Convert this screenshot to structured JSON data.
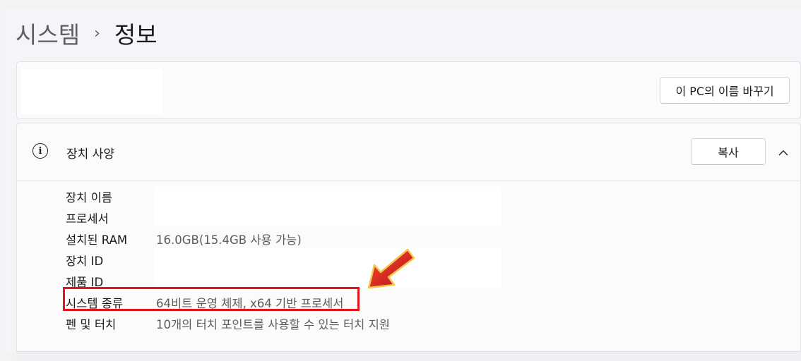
{
  "breadcrumb": {
    "parent": "시스템",
    "separator": "›",
    "current": "정보"
  },
  "name_card": {
    "rename_button": "이 PC의 이름 바꾸기"
  },
  "device_specs": {
    "title": "장치 사양",
    "copy_button": "복사",
    "icon": "info-icon",
    "rows": [
      {
        "label": "장치 이름",
        "value": ""
      },
      {
        "label": "프로세서",
        "value": ""
      },
      {
        "label": "설치된 RAM",
        "value": "16.0GB(15.4GB 사용 가능)"
      },
      {
        "label": "장치 ID",
        "value": ""
      },
      {
        "label": "제품 ID",
        "value": ""
      },
      {
        "label": "시스템 종류",
        "value": "64비트 운영 체제, x64 기반 프로세서"
      },
      {
        "label": "펜 및 터치",
        "value": "10개의 터치 포인트를 사용할 수 있는 터치 지원"
      }
    ]
  },
  "annotation": {
    "highlight_color": "#e3141c",
    "arrow_color": "#d21a1a"
  }
}
